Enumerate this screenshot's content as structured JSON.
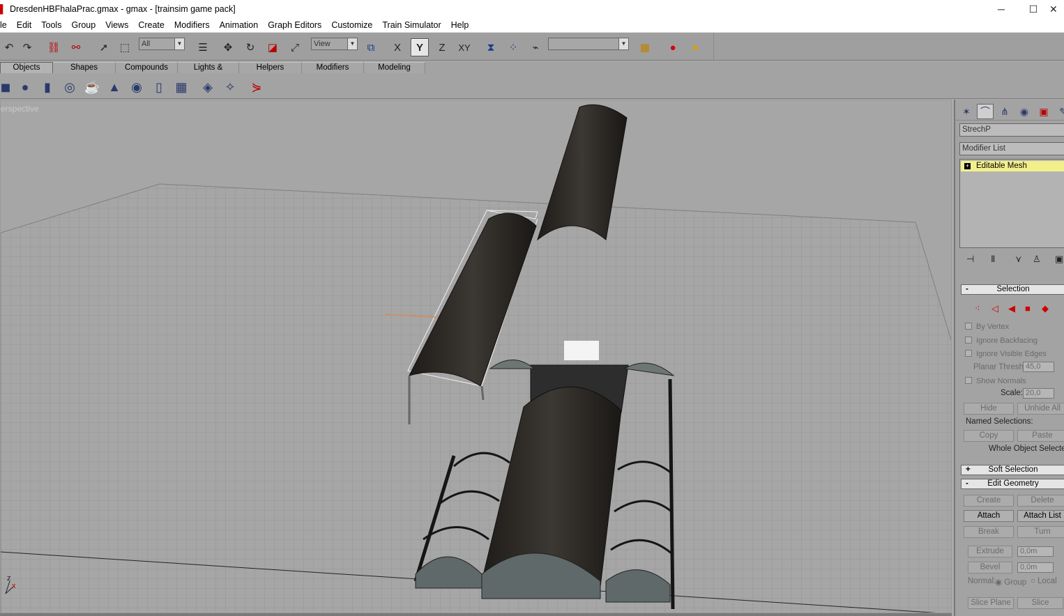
{
  "window": {
    "title": "DresdenHBFhalaPrac.gmax - gmax - [trainsim game pack]",
    "minimize": "─",
    "maximize": "☐",
    "close": "✕"
  },
  "menu": [
    "le",
    "Edit",
    "Tools",
    "Group",
    "Views",
    "Create",
    "Modifiers",
    "Animation",
    "Graph Editors",
    "Customize",
    "Train Simulator",
    "Help"
  ],
  "toolbar": {
    "selection_filter": "All",
    "reference_coord": "View",
    "named_selection": "",
    "axis_x": "X",
    "axis_y": "Y",
    "axis_z": "Z",
    "axis_xy": "XY"
  },
  "tabs": [
    "Objects",
    "Shapes",
    "Compounds",
    "Lights & Cameras",
    "Helpers",
    "Modifiers",
    "Modeling"
  ],
  "viewport": {
    "label": "erspective",
    "axis_z": "z",
    "axis_x": "x"
  },
  "panel": {
    "object_name": "StrechP",
    "modifier_list": "Modifier List",
    "stack_item": "Editable Mesh",
    "selection": {
      "header": "Selection",
      "by_vertex": "By Vertex",
      "ignore_backfacing": "Ignore Backfacing",
      "ignore_visible_edges": "Ignore Visible Edges",
      "planar_thresh_label": "Planar Thresh:",
      "planar_thresh_value": "45,0",
      "show_normals": "Show Normals",
      "scale_label": "Scale:",
      "scale_value": "20,0",
      "hide": "Hide",
      "unhide_all": "Unhide All",
      "named_selections": "Named Selections:",
      "copy": "Copy",
      "paste": "Paste",
      "status": "Whole Object Selected"
    },
    "soft_selection": "Soft Selection",
    "edit_geometry": {
      "header": "Edit Geometry",
      "create": "Create",
      "delete": "Delete",
      "attach": "Attach",
      "attach_list": "Attach List",
      "break": "Break",
      "turn": "Turn",
      "extrude": "Extrude",
      "extrude_value": "0,0m",
      "bevel": "Bevel",
      "bevel_value": "0,0m",
      "normal": "Normal:",
      "group": "Group",
      "local": "Local",
      "slice_plane": "Slice Plane",
      "slice": "Slice"
    }
  }
}
